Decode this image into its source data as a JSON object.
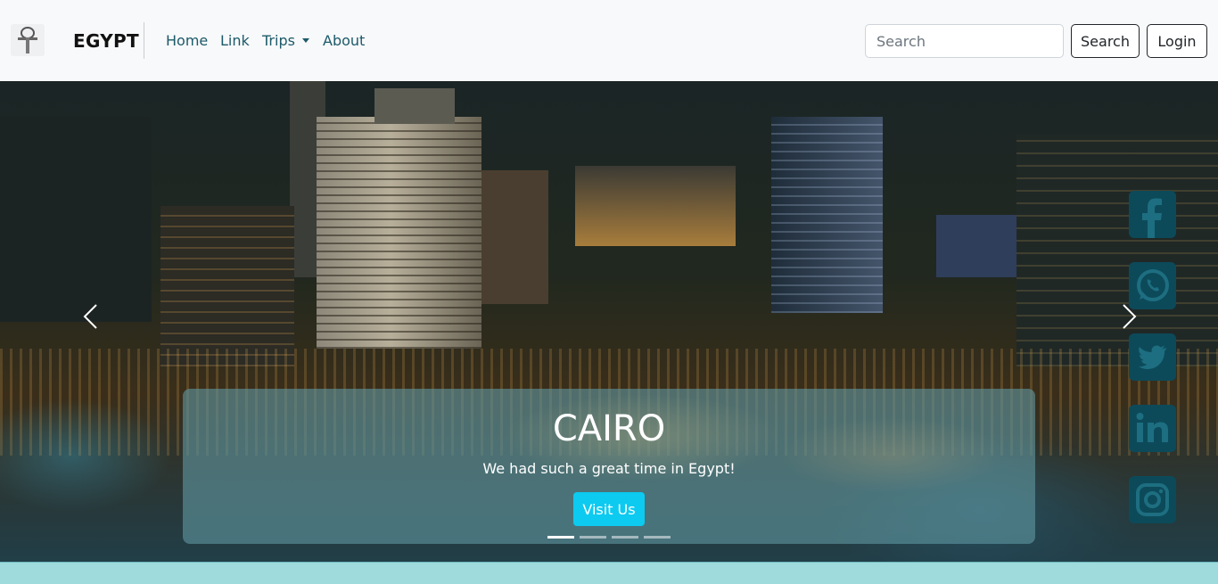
{
  "navbar": {
    "brand": "EGYPT",
    "logo_icon": "ankh-logo-icon",
    "links": [
      {
        "label": "Home"
      },
      {
        "label": "Link"
      },
      {
        "label": "Trips",
        "dropdown": true
      },
      {
        "label": "About"
      }
    ],
    "search": {
      "placeholder": "Search",
      "value": ""
    },
    "search_button": "Search",
    "login_button": "Login"
  },
  "carousel": {
    "caption": {
      "title": "CAIRO",
      "text": "We had such a great time in Egypt!",
      "button": "Visit Us"
    },
    "slide_count": 4,
    "active_slide": 1,
    "prev_icon": "chevron-left-icon",
    "next_icon": "chevron-right-icon"
  },
  "social": [
    {
      "name": "facebook-icon"
    },
    {
      "name": "whatsapp-icon"
    },
    {
      "name": "twitter-icon"
    },
    {
      "name": "linkedin-icon"
    },
    {
      "name": "instagram-icon"
    }
  ],
  "colors": {
    "navbar_bg": "#f8f9fa",
    "link": "#1c5a6a",
    "visit_button": "#0dcaf0",
    "social_icon": "#0c4a5a",
    "caption_bg": "rgba(95,150,160,0.62)",
    "bottom_band": "#9fdbdc"
  }
}
